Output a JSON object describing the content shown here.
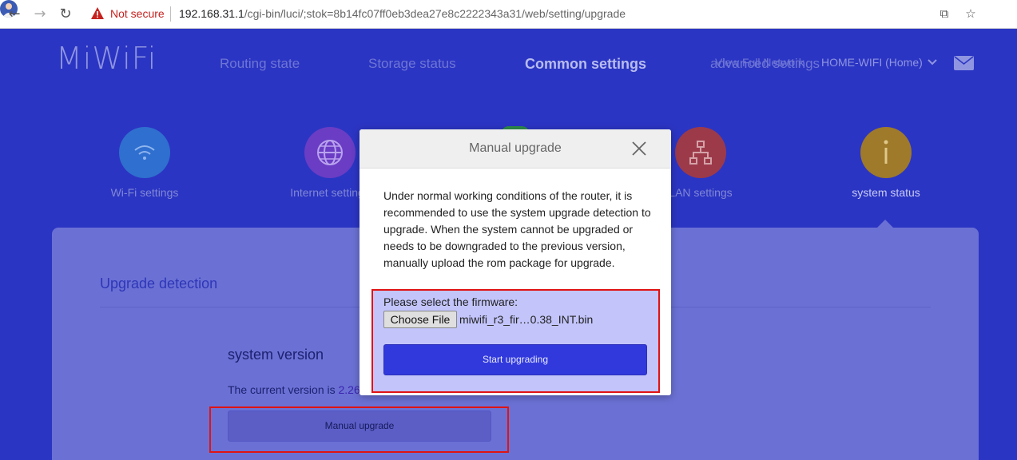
{
  "browser": {
    "security_label": "Not secure",
    "url_host": "192.168.31.1",
    "url_path": "/cgi-bin/luci/;stok=8b14fc07ff0eb3dea27e8c2222343a31/web/setting/upgrade",
    "icons": [
      "back-icon",
      "forward-icon",
      "reload-icon",
      "warning-icon",
      "translate-icon",
      "star-icon",
      "profile-icon"
    ]
  },
  "header": {
    "logo": "MiWiFi",
    "nav": {
      "routing": "Routing state",
      "storage": "Storage status",
      "common": "Common settings",
      "advanced": "advanced settings",
      "network": "View Full Network"
    },
    "network_name": "HOME-WIFI (Home)"
  },
  "features": {
    "wifi": "Wi-Fi settings",
    "internet": "Internet settings",
    "lan": "LAN settings",
    "status": "system status"
  },
  "upgrade": {
    "title": "Upgrade detection",
    "system_version": "system version",
    "current_version_label": "The current version is",
    "current_version_value": "2.26",
    "manual_button": "Manual upgrade"
  },
  "modal": {
    "title": "Manual upgrade",
    "description": "Under normal working conditions of the router, it is recommended to use the system upgrade detection to upgrade. When the system cannot be upgraded or needs to be downgraded to the previous version, manually upload the rom package for upgrade.",
    "select_label": "Please select the firmware:",
    "choose_button": "Choose File",
    "file_name": "miwifi_r3_fir…0.38_INT.bin",
    "start_button": "Start upgrading"
  },
  "colors": {
    "background": "#2b35c3",
    "highlight": "#e01313",
    "primary_button": "#3139dc"
  }
}
